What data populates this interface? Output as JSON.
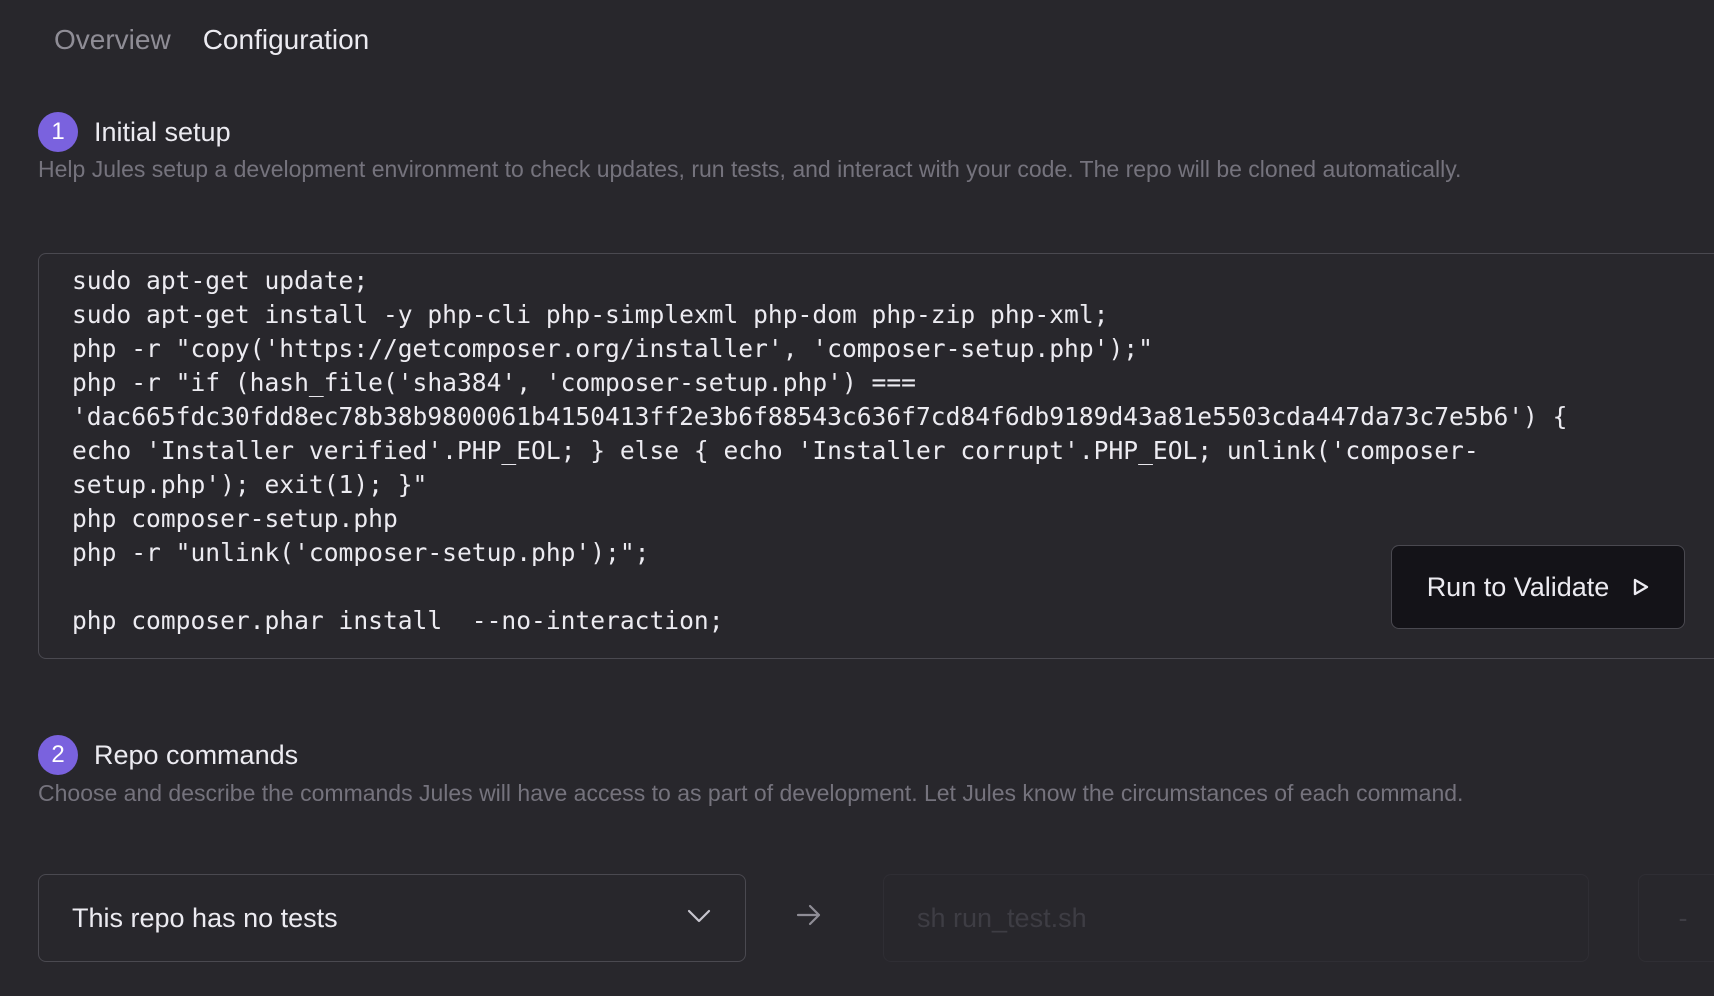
{
  "tabs": [
    {
      "label": "Overview",
      "active": false
    },
    {
      "label": "Configuration",
      "active": true
    }
  ],
  "step1": {
    "number": "1",
    "title": "Initial setup",
    "description": "Help Jules setup a development environment to check updates, run tests, and interact with your code. The repo will be cloned automatically.",
    "script": "sudo apt-get update;\nsudo apt-get install -y php-cli php-simplexml php-dom php-zip php-xml;\nphp -r \"copy('https://getcomposer.org/installer', 'composer-setup.php');\"\nphp -r \"if (hash_file('sha384', 'composer-setup.php') ===\n'dac665fdc30fdd8ec78b38b9800061b4150413ff2e3b6f88543c636f7cd84f6db9189d43a81e5503cda447da73c7e5b6') {\necho 'Installer verified'.PHP_EOL; } else { echo 'Installer corrupt'.PHP_EOL; unlink('composer-\nsetup.php'); exit(1); }\"\nphp composer-setup.php\nphp -r \"unlink('composer-setup.php');\";\n\nphp composer.phar install  --no-interaction;",
    "run_button_label": "Run to Validate"
  },
  "step2": {
    "number": "2",
    "title": "Repo commands",
    "description": "Choose and describe the commands Jules will have access to as part of development. Let Jules know the circumstances of each command.",
    "test_select_value": "This repo has no tests",
    "test_command_placeholder": "sh run_test.sh",
    "extra_button_label": "-"
  },
  "colors": {
    "background": "#28272c",
    "accent": "#7a62de",
    "button_bg": "#141318"
  },
  "icons": {
    "run": "play-icon",
    "select": "chevron-down-icon",
    "flow": "arrow-right-icon"
  }
}
